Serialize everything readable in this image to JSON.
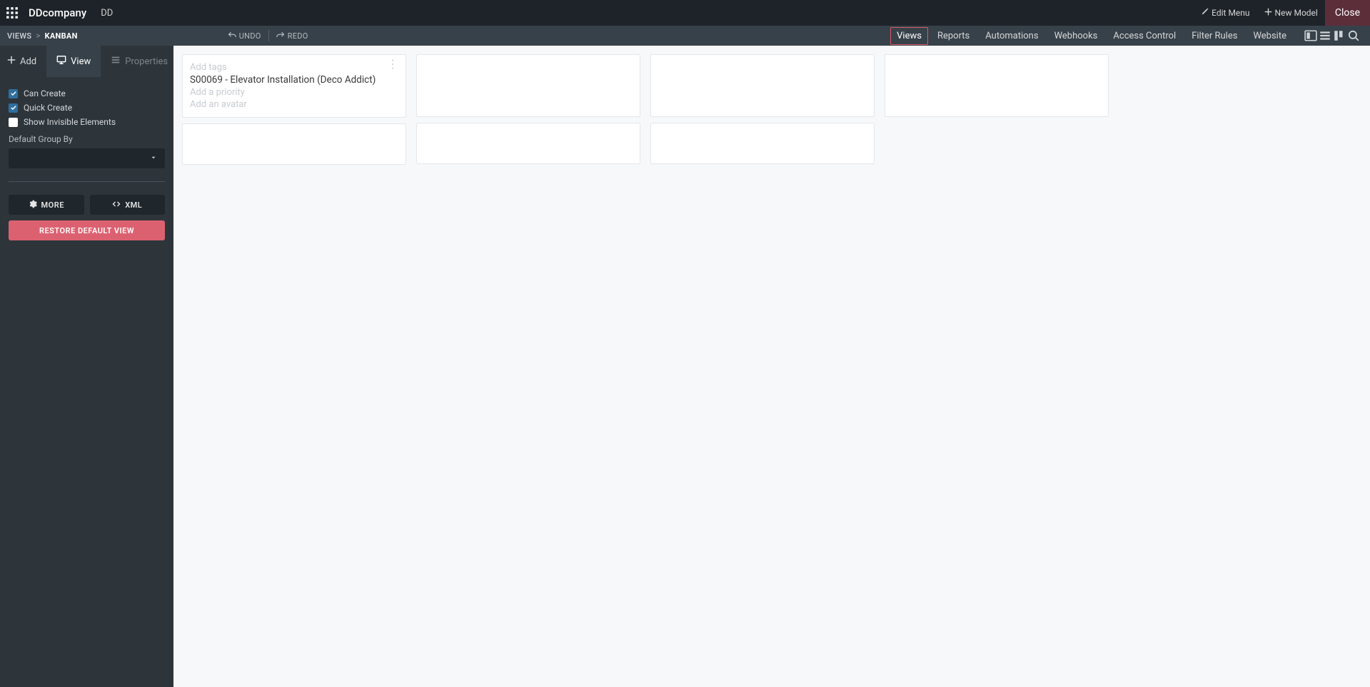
{
  "topbar": {
    "company": "DDcompany",
    "db": "DD",
    "edit_menu": "Edit Menu",
    "new_model": "New Model",
    "close": "Close"
  },
  "subbar": {
    "crumb_root": "VIEWS",
    "crumb_current": "KANBAN",
    "undo": "UNDO",
    "redo": "REDO",
    "tabs": {
      "views": "Views",
      "reports": "Reports",
      "automations": "Automations",
      "webhooks": "Webhooks",
      "access": "Access Control",
      "filter": "Filter Rules",
      "website": "Website"
    }
  },
  "sidebar": {
    "tab_add": "Add",
    "tab_view": "View",
    "tab_props": "Properties",
    "can_create": "Can Create",
    "quick_create": "Quick Create",
    "show_invisible": "Show Invisible Elements",
    "default_group_by": "Default Group By",
    "more": "MORE",
    "xml": "XML",
    "restore": "RESTORE DEFAULT VIEW"
  },
  "card": {
    "add_tags": "Add tags",
    "title": "S00069 - Elevator Installation (Deco Addict)",
    "add_priority": "Add a priority",
    "add_avatar": "Add an avatar"
  }
}
